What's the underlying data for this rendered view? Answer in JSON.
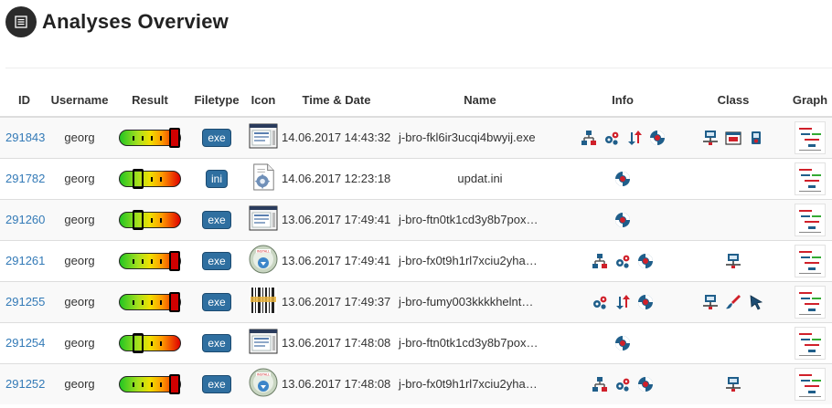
{
  "page": {
    "title": "Analyses Overview"
  },
  "columns": [
    "ID",
    "Username",
    "Result",
    "Filetype",
    "Icon",
    "Time & Date",
    "Name",
    "Info",
    "Class",
    "Graph"
  ],
  "rows": [
    {
      "id": "291843",
      "username": "georg",
      "result": 1.0,
      "filetype": "exe",
      "icon": "application-window-icon",
      "datetime": "14.06.2017 14:43:32",
      "name": "j-bro-fkl6ir3ucqi4bwyij.exe",
      "info": [
        "process-tree-icon",
        "gears-icon",
        "network-arrows-icon",
        "lifebuoy-icon"
      ],
      "class": [
        "monitor-network-icon",
        "browser-window-icon",
        "keylogger-icon"
      ]
    },
    {
      "id": "291782",
      "username": "georg",
      "result": 0.25,
      "filetype": "ini",
      "icon": "config-file-icon",
      "datetime": "14.06.2017 12:23:18",
      "name": "updat.ini",
      "info": [
        "lifebuoy-icon"
      ],
      "class": []
    },
    {
      "id": "291260",
      "username": "georg",
      "result": 0.25,
      "filetype": "exe",
      "icon": "application-window-icon",
      "datetime": "13.06.2017 17:49:41",
      "name": "j-bro-ftn0tk1cd3y8b7pox…",
      "info": [
        "lifebuoy-icon"
      ],
      "class": []
    },
    {
      "id": "291261",
      "username": "georg",
      "result": 1.0,
      "filetype": "exe",
      "icon": "installer-disc-icon",
      "datetime": "13.06.2017 17:49:41",
      "name": "j-bro-fx0t9h1rl7xciu2yha…",
      "info": [
        "process-tree-icon",
        "gears-icon",
        "lifebuoy-icon"
      ],
      "class": [
        "monitor-network-icon"
      ]
    },
    {
      "id": "291255",
      "username": "georg",
      "result": 1.0,
      "filetype": "exe",
      "icon": "barcode-file-icon",
      "datetime": "13.06.2017 17:49:37",
      "name": "j-bro-fumy003kkkkhelnt…",
      "info": [
        "gears-icon",
        "network-arrows-icon",
        "lifebuoy-icon"
      ],
      "class": [
        "monitor-network-icon",
        "brush-icon",
        "cursor-icon"
      ]
    },
    {
      "id": "291254",
      "username": "georg",
      "result": 0.25,
      "filetype": "exe",
      "icon": "application-window-icon",
      "datetime": "13.06.2017 17:48:08",
      "name": "j-bro-ftn0tk1cd3y8b7pox…",
      "info": [
        "lifebuoy-icon"
      ],
      "class": []
    },
    {
      "id": "291252",
      "username": "georg",
      "result": 1.0,
      "filetype": "exe",
      "icon": "installer-disc-icon",
      "datetime": "13.06.2017 17:48:08",
      "name": "j-bro-fx0t9h1rl7xciu2yha…",
      "info": [
        "process-tree-icon",
        "gears-icon",
        "lifebuoy-icon"
      ],
      "class": [
        "monitor-network-icon"
      ]
    }
  ],
  "colors": {
    "link": "#337ab7",
    "filetype_badge": "#2f6fa0",
    "row_stripe": "#f9f9f9"
  }
}
